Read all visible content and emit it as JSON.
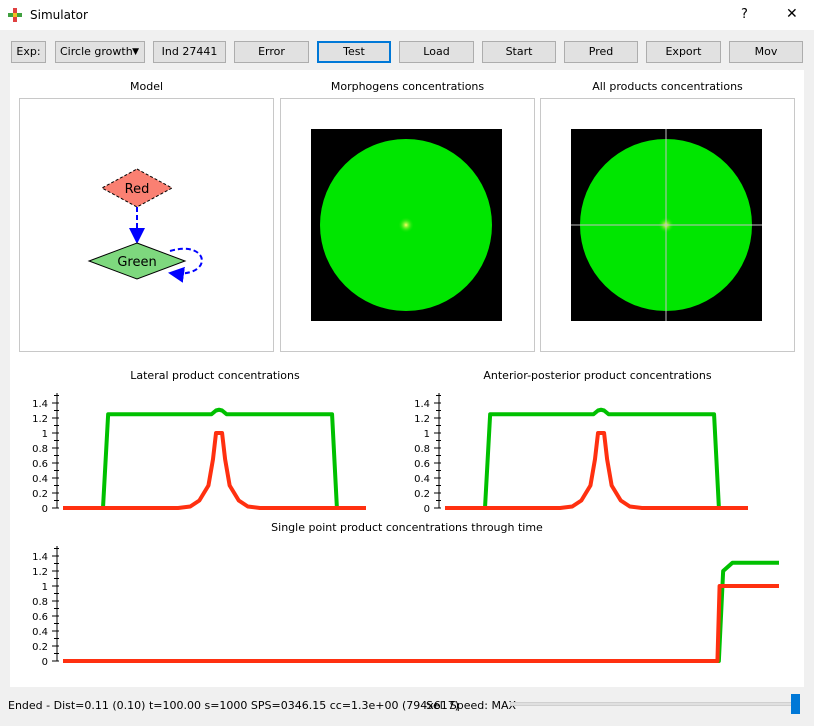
{
  "window": {
    "title": "Simulator",
    "help": "?",
    "close": "✕"
  },
  "toolbar": {
    "exp_label": "Exp:",
    "experiment": "Circle growth",
    "ind": "Ind 27441",
    "error": "Error",
    "test": "Test",
    "load": "Load",
    "start": "Start",
    "pred": "Pred",
    "export": "Export",
    "mov": "Mov"
  },
  "panels": {
    "model": "Model",
    "morphogens": "Morphogens concentrations",
    "all_products": "All products concentrations",
    "lateral": "Lateral product concentrations",
    "ap": "Anterior-posterior product concentrations",
    "single": "Single point product concentrations through time"
  },
  "model": {
    "nodes": [
      "Red",
      "Green"
    ],
    "colors": {
      "red": "#fa8072",
      "green": "#7ed87e",
      "edge": "#0000ff"
    }
  },
  "status": {
    "text": "Ended - Dist=0.11 (0.10) t=100.00 s=1000 SPS=0346.15 cc=1.3e+00 (794x617)",
    "speed_label": "Sel. Speed: MAX",
    "speed_level": 1.0
  },
  "chart_data": [
    {
      "type": "line",
      "title": "Lateral product concentrations",
      "ylim": [
        0,
        1.5
      ],
      "yticks": [
        "0",
        "0.2",
        "0.4",
        "0.6",
        "0.8",
        "1",
        "1.2",
        "1.4"
      ],
      "series": [
        {
          "color": "#00c000",
          "x": [
            0,
            13.2,
            14.9,
            49,
            50.5,
            51.5,
            52.5,
            54,
            88.8,
            90.4
          ],
          "y": [
            0,
            0,
            1.25,
            1.25,
            1.3,
            1.31,
            1.3,
            1.25,
            1.25,
            0
          ]
        },
        {
          "color": "#ff3010",
          "x": [
            0,
            38,
            42,
            45,
            48,
            49.5,
            50.5,
            51.5,
            52.5,
            53.5,
            55,
            58,
            61,
            65,
            100
          ],
          "y": [
            0,
            0,
            0.02,
            0.1,
            0.3,
            0.65,
            1.0,
            1.0,
            1.0,
            0.65,
            0.3,
            0.1,
            0.02,
            0,
            0
          ]
        }
      ]
    },
    {
      "type": "line",
      "title": "Anterior-posterior product concentrations",
      "ylim": [
        0,
        1.5
      ],
      "yticks": [
        "0",
        "0.2",
        "0.4",
        "0.6",
        "0.8",
        "1",
        "1.2",
        "1.4"
      ],
      "series": [
        {
          "color": "#00c000",
          "x": [
            0,
            13.2,
            14.9,
            49,
            50.5,
            51.5,
            52.5,
            54,
            88.8,
            90.4
          ],
          "y": [
            0,
            0,
            1.25,
            1.25,
            1.3,
            1.31,
            1.3,
            1.25,
            1.25,
            0
          ]
        },
        {
          "color": "#ff3010",
          "x": [
            0,
            38,
            42,
            45,
            48,
            49.5,
            50.5,
            51.5,
            52.5,
            53.5,
            55,
            58,
            61,
            65,
            100
          ],
          "y": [
            0,
            0,
            0.02,
            0.1,
            0.3,
            0.65,
            1.0,
            1.0,
            1.0,
            0.65,
            0.3,
            0.1,
            0.02,
            0,
            0
          ]
        }
      ]
    },
    {
      "type": "line",
      "title": "Single point product concentrations through time",
      "ylim": [
        0,
        1.5
      ],
      "yticks": [
        "0",
        "0.2",
        "0.4",
        "0.6",
        "0.8",
        "1",
        "1.2",
        "1.4"
      ],
      "series": [
        {
          "color": "#00c000",
          "x": [
            0,
            91.6,
            92.2,
            93.5,
            100
          ],
          "y": [
            0,
            0,
            1.2,
            1.31,
            1.31
          ]
        },
        {
          "color": "#ff3010",
          "x": [
            0,
            91.4,
            91.7,
            100
          ],
          "y": [
            0,
            0,
            1.0,
            1.0
          ]
        }
      ]
    }
  ]
}
